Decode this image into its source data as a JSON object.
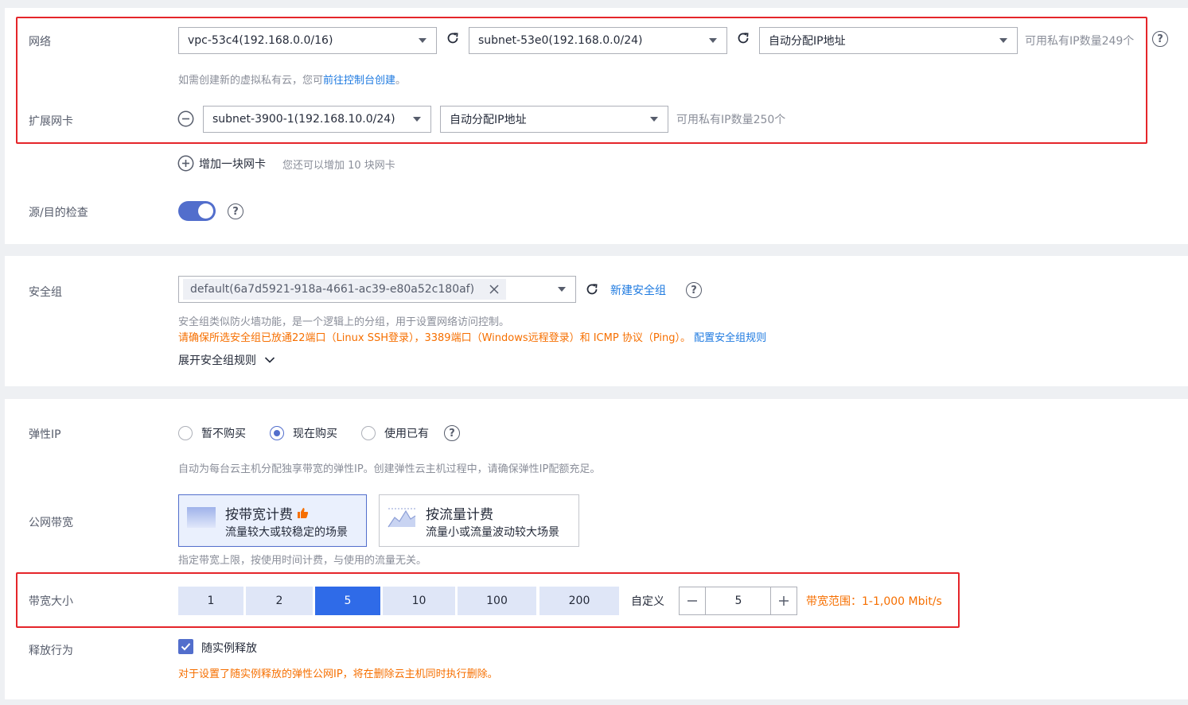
{
  "network": {
    "label": "网络",
    "vpc_value": "vpc-53c4(192.168.0.0/16)",
    "subnet_value": "subnet-53e0(192.168.0.0/24)",
    "ip_mode_value": "自动分配IP地址",
    "available_ip_text": "可用私有IP数量249个",
    "vpc_hint_prefix": "如需创建新的虚拟私有云，您可",
    "vpc_hint_link": "前往控制台创建",
    "vpc_hint_suffix": "。"
  },
  "ext_nic": {
    "label": "扩展网卡",
    "subnet_value": "subnet-3900-1(192.168.10.0/24)",
    "ip_mode_value": "自动分配IP地址",
    "available_ip_text": "可用私有IP数量250个",
    "add_label": "增加一块网卡",
    "add_hint": "您还可以增加 10 块网卡"
  },
  "src_dst_check": {
    "label": "源/目的检查",
    "enabled": true
  },
  "security_group": {
    "label": "安全组",
    "tag_value": "default(6a7d5921-918a-4661-ac39-e80a52c180af)",
    "new_link": "新建安全组",
    "desc": "安全组类似防火墙功能，是一个逻辑上的分组，用于设置网络访问控制。",
    "warn_text": "请确保所选安全组已放通22端口（Linux SSH登录），3389端口（Windows远程登录）和 ICMP 协议（Ping）。",
    "config_link": "配置安全组规则",
    "expand_label": "展开安全组规则"
  },
  "eip": {
    "label": "弹性IP",
    "options": [
      "暂不购买",
      "现在购买",
      "使用已有"
    ],
    "selected_index": 1,
    "hint": "自动为每台云主机分配独享带宽的弹性IP。创建弹性云主机过程中，请确保弹性IP配额充足。"
  },
  "public_bw": {
    "label": "公网带宽",
    "bill_by_bw_title": "按带宽计费",
    "bill_by_bw_sub": "流量较大或较稳定的场景",
    "bill_by_traffic_title": "按流量计费",
    "bill_by_traffic_sub": "流量小或流量波动较大场景",
    "hint": "指定带宽上限，按使用时间计费，与使用的流量无关。"
  },
  "bandwidth": {
    "label": "带宽大小",
    "options": [
      "1",
      "2",
      "5",
      "10",
      "100",
      "200"
    ],
    "selected": "5",
    "custom_label": "自定义",
    "custom_value": "5",
    "range_text": "带宽范围：1-1,000 Mbit/s"
  },
  "release": {
    "label": "释放行为",
    "checkbox_label": "随实例释放",
    "checked": true,
    "warn_text": "对于设置了随实例释放的弹性公网IP，将在删除云主机同时执行删除。"
  },
  "colors": {
    "accent": "#526ecc",
    "primary_button": "#2f6be8",
    "link": "#1e7ae0",
    "warning": "#f66f00",
    "highlight_box": "#e5252a"
  }
}
